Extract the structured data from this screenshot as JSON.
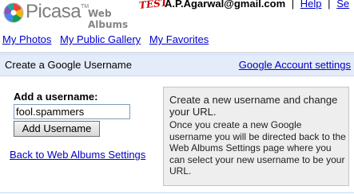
{
  "header": {
    "logo_word": "Picasa",
    "logo_tm": "TM",
    "logo_sub": "Web Albums",
    "logo_badge": "TEST",
    "user_email": "A.P.Agarwal@gmail.com",
    "separator": "|",
    "help_link": "Help",
    "settings_link_partial": "Se"
  },
  "nav": {
    "my_photos": "My Photos",
    "public_gallery": "My Public Gallery",
    "favorites": "My Favorites"
  },
  "section": {
    "title": "Create a Google Username",
    "account_settings_link": "Google Account settings"
  },
  "form": {
    "label": "Add a username:",
    "username_value": "fool.spammers",
    "add_button": "Add Username",
    "back_link": "Back to Web Albums Settings"
  },
  "info": {
    "title": "Create a new username and change your URL.",
    "body": "Once you create a new Google username you will be directed back to the Web Albums Settings page where you can select your new username to be your URL."
  },
  "colors": {
    "link": "#0000cc",
    "bar_background": "#e5ecf9",
    "info_background": "#eeeeee",
    "badge_red": "#cc0000"
  },
  "icons": {
    "logo": "picasa-pinwheel-icon"
  }
}
